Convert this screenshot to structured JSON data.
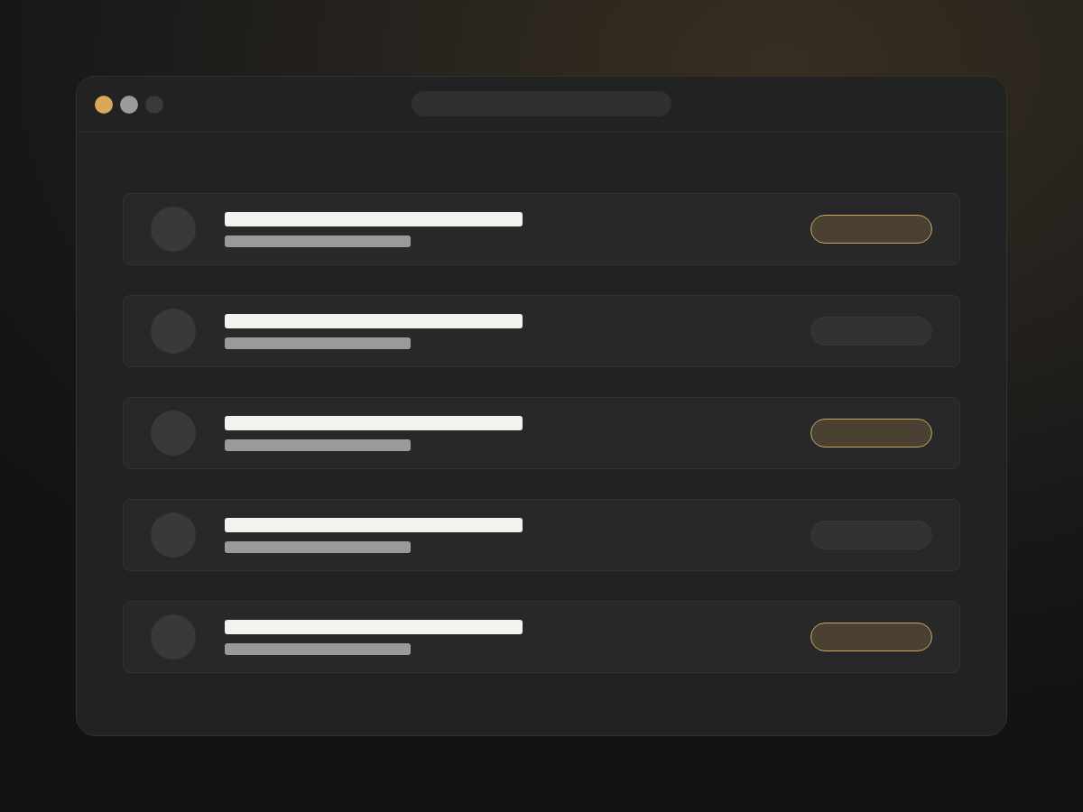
{
  "window": {
    "controls": [
      {
        "color": "#d9a85a"
      },
      {
        "color": "#9b9b9b"
      },
      {
        "color": "#3a3a3a"
      }
    ]
  },
  "list": {
    "rows": [
      {
        "highlighted": true
      },
      {
        "highlighted": false
      },
      {
        "highlighted": true
      },
      {
        "highlighted": false
      },
      {
        "highlighted": true
      }
    ]
  }
}
